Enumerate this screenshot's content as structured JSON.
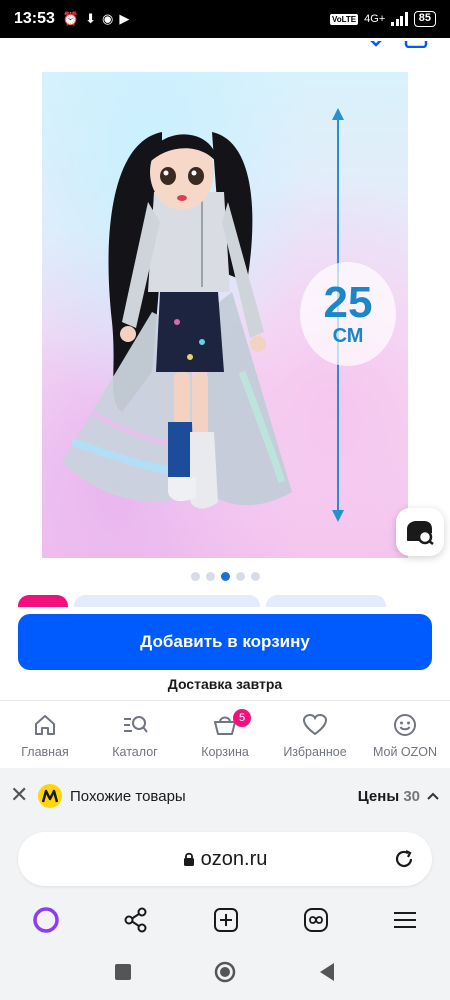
{
  "status_bar": {
    "time": "13:53",
    "network": "4G+",
    "battery": "85",
    "volte": "VoLTE"
  },
  "product": {
    "size_value": "25",
    "size_unit": "СМ",
    "carousel_active_index": 2,
    "carousel_count": 5
  },
  "actions": {
    "add_to_cart": "Добавить в корзину",
    "delivery": "Доставка завтра"
  },
  "tabs": [
    {
      "label": "Главная",
      "icon": "home-icon"
    },
    {
      "label": "Каталог",
      "icon": "catalog-search-icon"
    },
    {
      "label": "Корзина",
      "icon": "cart-icon",
      "badge": "5"
    },
    {
      "label": "Избранное",
      "icon": "heart-icon"
    },
    {
      "label": "Мой OZON",
      "icon": "smiley-icon"
    }
  ],
  "similar_bar": {
    "title": "Похожие товары",
    "prices_label": "Цены",
    "prices_count": "30"
  },
  "browser": {
    "url": "ozon.ru"
  },
  "colors": {
    "accent": "#005bff",
    "badge": "#f1117e",
    "size_label": "#1b86c8"
  }
}
